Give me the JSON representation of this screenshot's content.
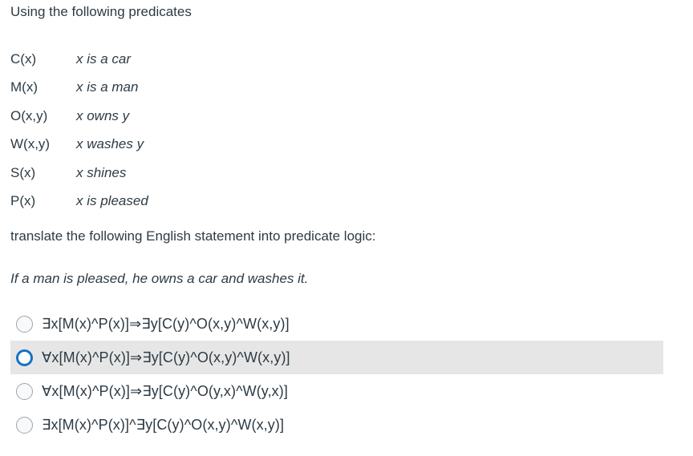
{
  "intro": "Using the following predicates",
  "predicates": [
    {
      "symbol": "C(x)",
      "meaning": "x is a car"
    },
    {
      "symbol": "M(x)",
      "meaning": "x is a man"
    },
    {
      "symbol": "O(x,y)",
      "meaning": "x owns y"
    },
    {
      "symbol": "W(x,y)",
      "meaning": "x washes y"
    },
    {
      "symbol": "S(x)",
      "meaning": "x shines"
    },
    {
      "symbol": "P(x)",
      "meaning": "x is pleased"
    }
  ],
  "prompt": "translate the following English statement into predicate logic:",
  "statement": "If a man is pleased, he owns a car and washes it.",
  "options": [
    {
      "text": "∃x[M(x)^P(x)]⇒∃y[C(y)^O(x,y)^W(x,y)]",
      "highlighted": false
    },
    {
      "text": "∀x[M(x)^P(x)]⇒∃y[C(y)^O(x,y)^W(x,y)]",
      "highlighted": true
    },
    {
      "text": "∀x[M(x)^P(x)]⇒∃y[C(y)^O(y,x)^W(y,x)]",
      "highlighted": false
    },
    {
      "text": "∃x[M(x)^P(x)]^∃y[C(y)^O(x,y)^W(x,y)]",
      "highlighted": false
    }
  ],
  "colors": {
    "text": "#2d3b45",
    "highlight_background": "#e6e6e6",
    "selected_radio": "#1673c4",
    "radio_border": "#a0a4a8"
  }
}
